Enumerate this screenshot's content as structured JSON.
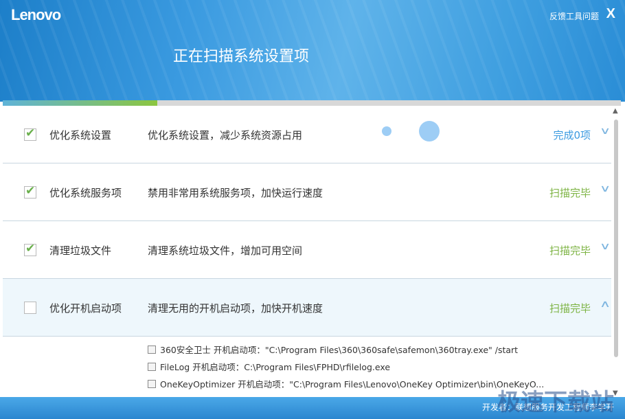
{
  "app": {
    "logo": "Lenovo",
    "feedback": "反馈工具问题",
    "close": "X",
    "title": "正在扫描系统设置项",
    "progress_percent": 25
  },
  "items": [
    {
      "name": "优化系统设置",
      "desc": "优化系统设置，减少系统资源占用",
      "status": "完成0项",
      "checked": true
    },
    {
      "name": "优化系统服务项",
      "desc": "禁用非常用系统服务项，加快运行速度",
      "status": "扫描完毕",
      "checked": true
    },
    {
      "name": "清理垃圾文件",
      "desc": "清理系统垃圾文件，增加可用空间",
      "status": "扫描完毕",
      "checked": true
    },
    {
      "name": "优化开机启动项",
      "desc": "清理无用的开机启动项，加快开机速度",
      "status": "扫描完毕",
      "checked": false
    }
  ],
  "startup_items": [
    "360安全卫士 开机启动项：\"C:\\Program Files\\360\\360safe\\safemon\\360tray.exe\" /start",
    "FileLog 开机启动项：C:\\Program Files\\FPHD\\rfilelog.exe",
    "OneKeyOptimizer 开机启动项：\"C:\\Program Files\\Lenovo\\OneKey Optimizer\\bin\\OneKeyO..."
  ],
  "footer": {
    "developer": "开发者：联想服务开发工程师李学开"
  },
  "watermark": "极速下载站",
  "colors": {
    "header": "#3a9ae0",
    "status_green": "#7cb342",
    "status_blue": "#3a9ae0"
  }
}
